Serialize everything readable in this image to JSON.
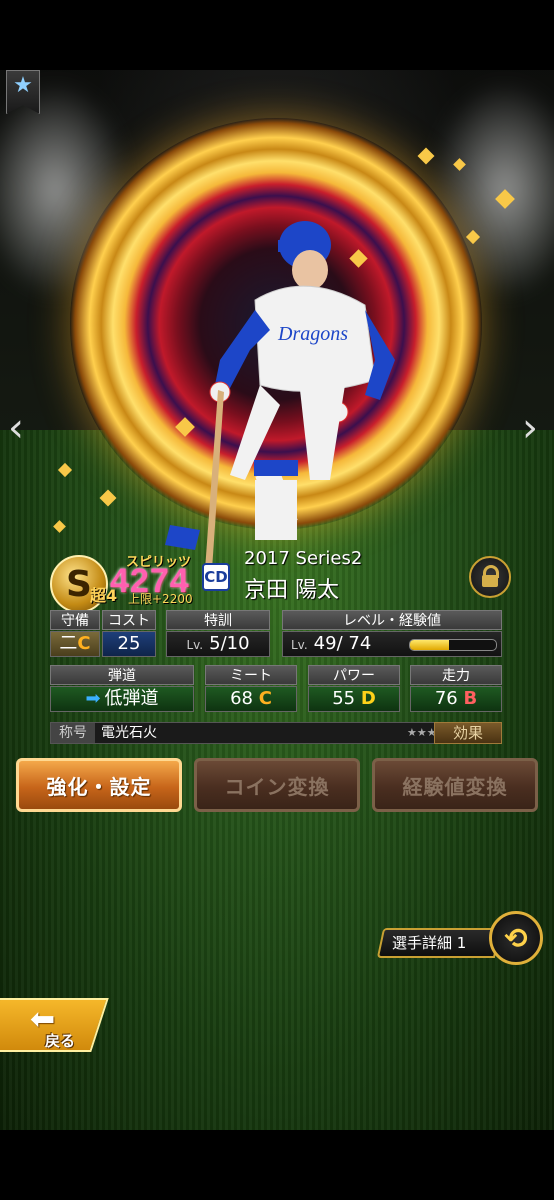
{
  "player": {
    "rank_letter": "S",
    "rank_sub": "超4",
    "spirit_label": "スピリッツ",
    "spirit_value": "4274",
    "spirit_cap": "上限+2200",
    "team_logo": "CD",
    "series": "2017 Series2",
    "name": "京田 陽太"
  },
  "stats": {
    "position_header": "守備",
    "position_value": "二",
    "position_grade": "C",
    "cost_header": "コスト",
    "cost_value": "25",
    "training_header": "特訓",
    "training_lv": "Lv.",
    "training_value": "5/10",
    "level_header": "レベル・経験値",
    "level_lv": "Lv.",
    "level_value": "49/ 74",
    "exp_progress": 0.45,
    "trajectory_header": "弾道",
    "trajectory_value": "低弾道",
    "meet_header": "ミート",
    "meet_value": "68",
    "meet_grade": "C",
    "power_header": "パワー",
    "power_value": "55",
    "power_grade": "D",
    "speed_header": "走力",
    "speed_value": "76",
    "speed_grade": "B"
  },
  "title_row": {
    "label": "称号",
    "value": "電光石火",
    "stars": "★★★★",
    "effect_button": "効果"
  },
  "actions": {
    "enhance": "強化・設定",
    "coin": "コイン変換",
    "exp": "経験値変換"
  },
  "detail_tab": "選手詳細 1",
  "back_label": "戻る",
  "nav": {
    "prev": "‹",
    "next": "›"
  },
  "colors": {
    "accent_gold": "#e0b03a",
    "button_orange": "#c7651a",
    "spirit_pink": "#ff5fb0"
  },
  "icons": [
    "star-icon",
    "chevron-left-icon",
    "chevron-right-icon",
    "lock-icon",
    "arrow-right-icon",
    "swap-icon",
    "back-arrow-icon"
  ]
}
